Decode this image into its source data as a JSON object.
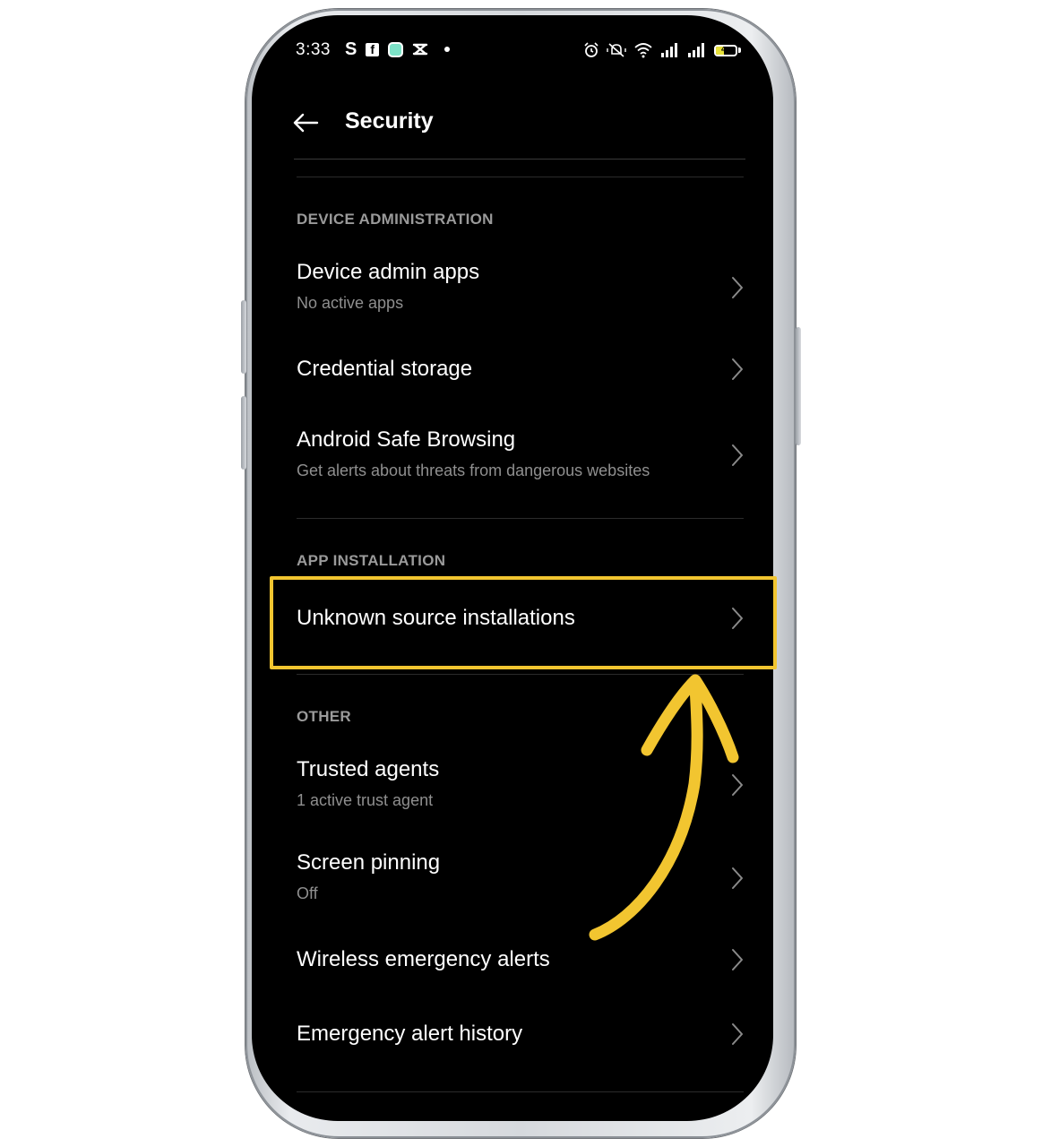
{
  "status_bar": {
    "time": "3:33",
    "left_icons": [
      "s-app-icon",
      "facebook-icon",
      "messenger-icon",
      "capcut-icon",
      "notification-dot-icon"
    ],
    "right_icons": [
      "alarm-icon",
      "mute-vibrate-icon",
      "wifi-icon",
      "signal-icon",
      "signal-icon-2"
    ],
    "battery_level": "41"
  },
  "header": {
    "title": "Security"
  },
  "sections": {
    "device_administration": {
      "header": "DEVICE ADMINISTRATION",
      "items": [
        {
          "title": "Device admin apps",
          "subtitle": "No active apps"
        },
        {
          "title": "Credential storage",
          "subtitle": ""
        },
        {
          "title": "Android Safe Browsing",
          "subtitle": "Get alerts about threats from dangerous websites"
        }
      ]
    },
    "app_installation": {
      "header": "APP INSTALLATION",
      "items": [
        {
          "title": "Unknown source installations",
          "subtitle": ""
        }
      ]
    },
    "other": {
      "header": "OTHER",
      "items": [
        {
          "title": "Trusted agents",
          "subtitle": "1 active trust agent"
        },
        {
          "title": "Screen pinning",
          "subtitle": "Off"
        },
        {
          "title": "Wireless emergency alerts",
          "subtitle": ""
        },
        {
          "title": "Emergency alert history",
          "subtitle": ""
        }
      ]
    }
  },
  "annotation": {
    "highlight_color": "#f2c530",
    "arrow_color": "#f2c530"
  },
  "colors": {
    "screen_background": "#000000",
    "text_primary": "#ffffff",
    "text_secondary": "#8f8f8f",
    "section_header": "#9a9a9a"
  }
}
